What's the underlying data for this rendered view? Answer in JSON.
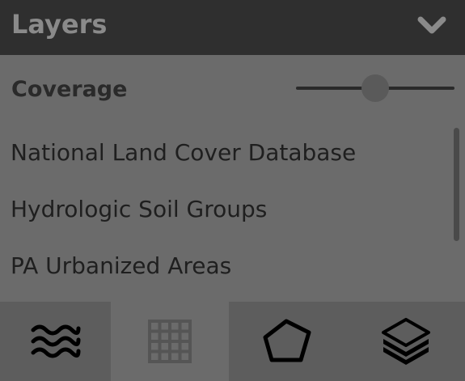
{
  "header": {
    "title": "Layers",
    "toggle_icon": "chevron-down-icon"
  },
  "coverage": {
    "label": "Coverage",
    "slider_value": 0.5
  },
  "layers": [
    {
      "label": "National Land Cover Database"
    },
    {
      "label": "Hydrologic Soil Groups"
    },
    {
      "label": "PA Urbanized Areas"
    }
  ],
  "tabs": [
    {
      "icon": "waves-icon",
      "active": false
    },
    {
      "icon": "grid-icon",
      "active": true
    },
    {
      "icon": "pentagon-icon",
      "active": false
    },
    {
      "icon": "layers-stack-icon",
      "active": false
    }
  ],
  "colors": {
    "header_bg": "#2f2f2f",
    "panel_bg": "#6b6b6b",
    "tab_dark_bg": "#5d5d5d",
    "text_dark": "#1f1f1f",
    "icon_black": "#000000",
    "icon_muted": "#555555"
  }
}
